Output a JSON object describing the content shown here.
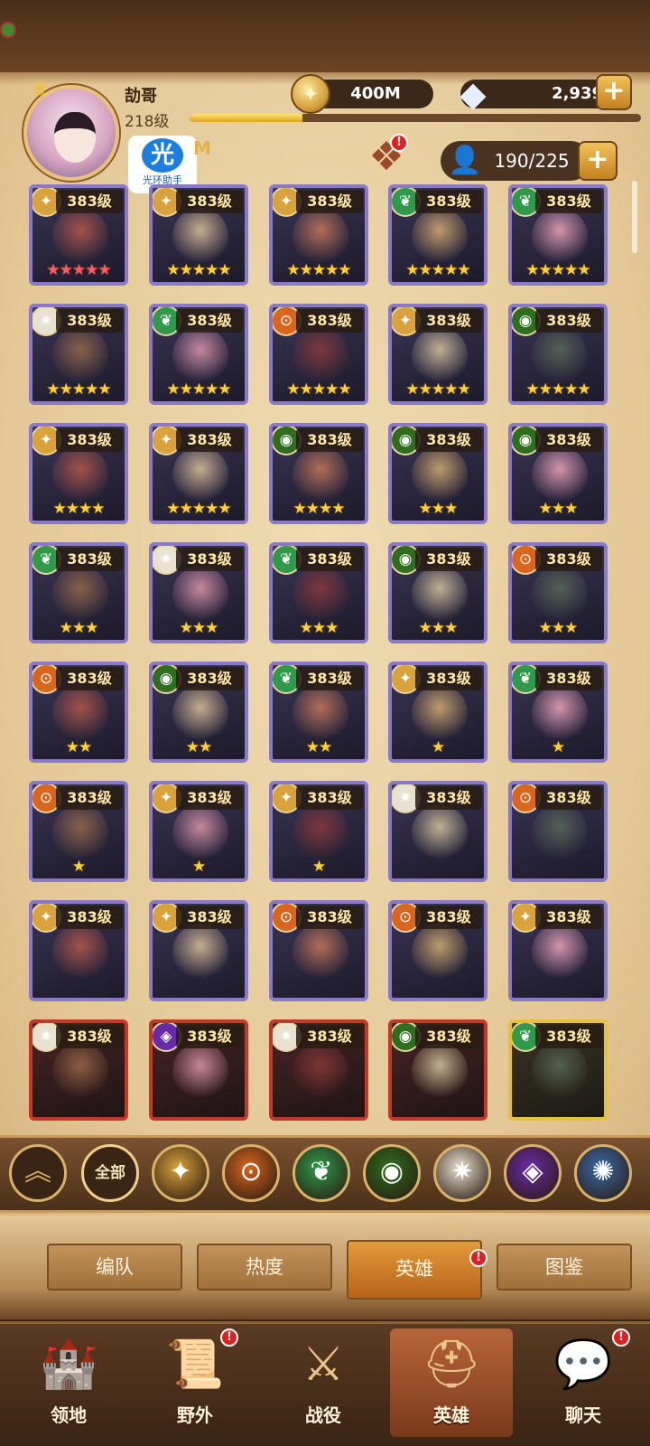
{
  "player": {
    "name": "劼哥",
    "level": "218级",
    "xp_fraction": 0.25
  },
  "currency": {
    "gold": "400M",
    "gems": "2,939",
    "gold_icon": "gold-coin-icon",
    "gem_icon": "diamond-icon"
  },
  "helper_badge": {
    "glyph": "光",
    "label": "光环助手"
  },
  "power_peek": "M",
  "hero_capacity": "190/225",
  "heroes": [
    {
      "level": "383级",
      "stars": "★★★★★",
      "star_color": "red",
      "faction": "lightbearer",
      "frame": "purple"
    },
    {
      "level": "383级",
      "stars": "★★★★★",
      "star_color": "gold",
      "faction": "lightbearer",
      "frame": "purple"
    },
    {
      "level": "383级",
      "stars": "★★★★★",
      "star_color": "gold",
      "faction": "lightbearer",
      "frame": "purple"
    },
    {
      "level": "383级",
      "stars": "★★★★★",
      "star_color": "gold",
      "faction": "wilder",
      "frame": "purple"
    },
    {
      "level": "383级",
      "stars": "★★★★★",
      "star_color": "gold",
      "faction": "wilder",
      "frame": "purple"
    },
    {
      "level": "383级",
      "stars": "★★★★★",
      "star_color": "gold",
      "faction": "celestial",
      "frame": "purple"
    },
    {
      "level": "383级",
      "stars": "★★★★★",
      "star_color": "gold",
      "faction": "wilder",
      "frame": "purple"
    },
    {
      "level": "383级",
      "stars": "★★★★★",
      "star_color": "gold",
      "faction": "mauler",
      "frame": "purple"
    },
    {
      "level": "383级",
      "stars": "★★★★★",
      "star_color": "gold",
      "faction": "lightbearer",
      "frame": "purple"
    },
    {
      "level": "383级",
      "stars": "★★★★★",
      "star_color": "gold",
      "faction": "graveborn",
      "frame": "purple"
    },
    {
      "level": "383级",
      "stars": "★★★★",
      "star_color": "gold",
      "faction": "lightbearer",
      "frame": "purple"
    },
    {
      "level": "383级",
      "stars": "★★★★★",
      "star_color": "gold",
      "faction": "lightbearer",
      "frame": "purple"
    },
    {
      "level": "383级",
      "stars": "★★★★",
      "star_color": "gold",
      "faction": "graveborn",
      "frame": "purple"
    },
    {
      "level": "383级",
      "stars": "★★★",
      "star_color": "gold",
      "faction": "graveborn",
      "frame": "purple"
    },
    {
      "level": "383级",
      "stars": "★★★",
      "star_color": "gold",
      "faction": "graveborn",
      "frame": "purple"
    },
    {
      "level": "383级",
      "stars": "★★★",
      "star_color": "gold",
      "faction": "wilder",
      "frame": "purple"
    },
    {
      "level": "383级",
      "stars": "★★★",
      "star_color": "gold",
      "faction": "celestial",
      "frame": "purple"
    },
    {
      "level": "383级",
      "stars": "★★★",
      "star_color": "gold",
      "faction": "wilder",
      "frame": "purple"
    },
    {
      "level": "383级",
      "stars": "★★★",
      "star_color": "gold",
      "faction": "graveborn",
      "frame": "purple"
    },
    {
      "level": "383级",
      "stars": "★★★",
      "star_color": "gold",
      "faction": "mauler",
      "frame": "purple"
    },
    {
      "level": "383级",
      "stars": "★★",
      "star_color": "gold",
      "faction": "mauler",
      "frame": "purple"
    },
    {
      "level": "383级",
      "stars": "★★",
      "star_color": "gold",
      "faction": "graveborn",
      "frame": "purple"
    },
    {
      "level": "383级",
      "stars": "★★",
      "star_color": "gold",
      "faction": "wilder",
      "frame": "purple"
    },
    {
      "level": "383级",
      "stars": "★",
      "star_color": "gold",
      "faction": "lightbearer",
      "frame": "purple"
    },
    {
      "level": "383级",
      "stars": "★",
      "star_color": "gold",
      "faction": "wilder",
      "frame": "purple"
    },
    {
      "level": "383级",
      "stars": "★",
      "star_color": "gold",
      "faction": "mauler",
      "frame": "purple"
    },
    {
      "level": "383级",
      "stars": "★",
      "star_color": "gold",
      "faction": "lightbearer",
      "frame": "purple"
    },
    {
      "level": "383级",
      "stars": "★",
      "star_color": "gold",
      "faction": "lightbearer",
      "frame": "purple"
    },
    {
      "level": "383级",
      "stars": "",
      "star_color": "gold",
      "faction": "celestial",
      "frame": "purple"
    },
    {
      "level": "383级",
      "stars": "",
      "star_color": "gold",
      "faction": "mauler",
      "frame": "purple"
    },
    {
      "level": "383级",
      "stars": "",
      "star_color": "gold",
      "faction": "lightbearer",
      "frame": "purple"
    },
    {
      "level": "383级",
      "stars": "",
      "star_color": "gold",
      "faction": "lightbearer",
      "frame": "purple"
    },
    {
      "level": "383级",
      "stars": "",
      "star_color": "gold",
      "faction": "mauler",
      "frame": "purple"
    },
    {
      "level": "383级",
      "stars": "",
      "star_color": "gold",
      "faction": "mauler",
      "frame": "purple"
    },
    {
      "level": "383级",
      "stars": "",
      "star_color": "gold",
      "faction": "lightbearer",
      "frame": "purple"
    },
    {
      "level": "383级",
      "stars": "",
      "star_color": "gold",
      "faction": "celestial",
      "frame": "red"
    },
    {
      "level": "383级",
      "stars": "",
      "star_color": "gold",
      "faction": "hypogean",
      "frame": "red"
    },
    {
      "level": "383级",
      "stars": "",
      "star_color": "gold",
      "faction": "celestial",
      "frame": "red"
    },
    {
      "level": "383级",
      "stars": "",
      "star_color": "gold",
      "faction": "graveborn",
      "frame": "red"
    },
    {
      "level": "383级",
      "stars": "",
      "star_color": "gold",
      "faction": "wilder",
      "frame": "gold"
    }
  ],
  "faction_filters": {
    "collapse_icon": "chevron-up-icon",
    "all_label": "全部",
    "items": [
      {
        "name": "lightbearer",
        "color": "#d9a23a"
      },
      {
        "name": "mauler",
        "color": "#d8661e"
      },
      {
        "name": "wilder",
        "color": "#2f9a4a"
      },
      {
        "name": "graveborn",
        "color": "#2e6e1e"
      },
      {
        "name": "celestial",
        "color": "#e8e2d0"
      },
      {
        "name": "hypogean",
        "color": "#6a2aa8"
      },
      {
        "name": "dimensional",
        "color": "#3a6aa8"
      }
    ]
  },
  "sub_tabs": [
    "编队",
    "热度",
    "英雄",
    "图鉴"
  ],
  "bottom_nav": [
    "领地",
    "野外",
    "战役",
    "英雄",
    "聊天"
  ],
  "colors": {
    "accent_gold": "#e0a21e",
    "notification_red": "#e02020",
    "frame_purple": "#8a78c8"
  }
}
